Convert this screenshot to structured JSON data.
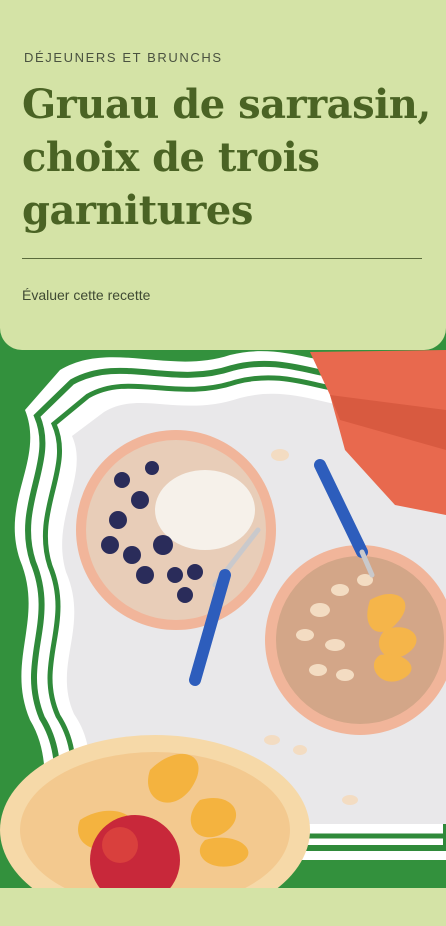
{
  "header": {
    "category": "DÉJEUNERS ET BRUNCHS",
    "title": "Gruau de sarrasin, choix de trois garnitures",
    "rate_label": "Évaluer cette recette"
  },
  "colors": {
    "background": "#d4e3a6",
    "title": "#4a6324",
    "accent_green": "#2f8a3a",
    "napkin": "#e8694e"
  },
  "photo": {
    "description_icon": "food-photo"
  }
}
